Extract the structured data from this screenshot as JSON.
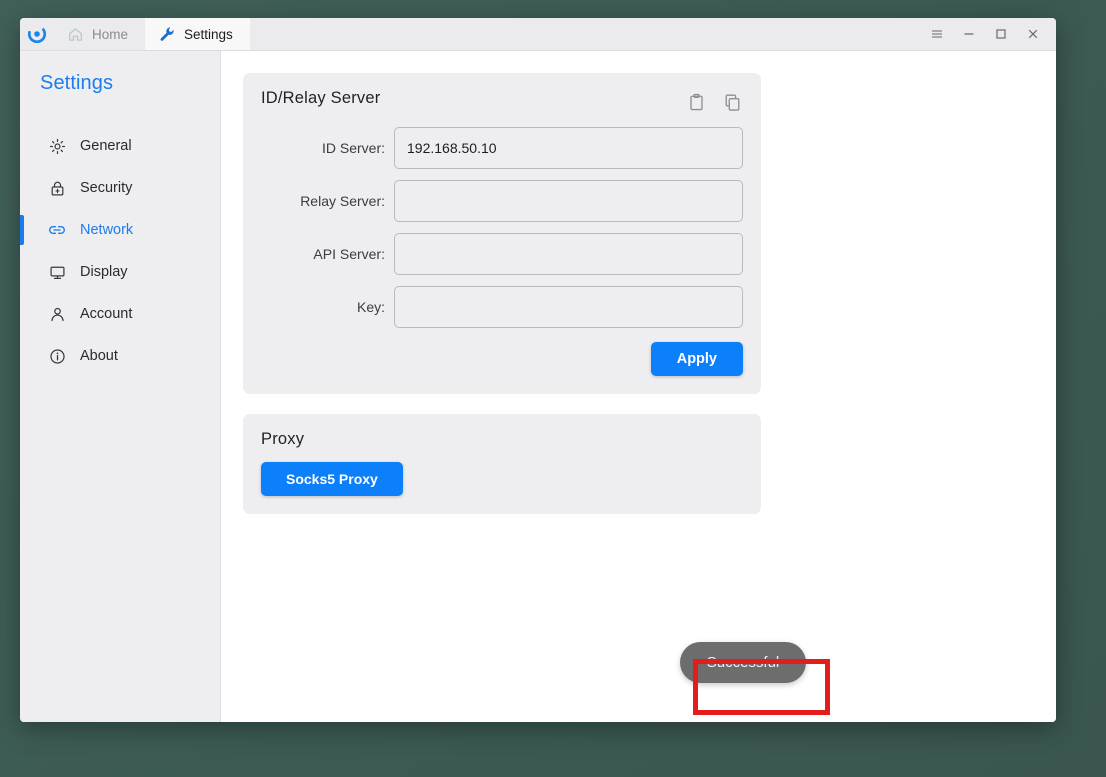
{
  "window": {
    "logo_icon": "app-logo-icon",
    "tabs": [
      {
        "label": "Home",
        "icon": "home-icon",
        "active": false
      },
      {
        "label": "Settings",
        "icon": "wrench-icon",
        "active": true
      }
    ],
    "controls": [
      {
        "name": "menu-button",
        "icon": "hamburger-icon"
      },
      {
        "name": "minimize-button",
        "icon": "minimize-icon"
      },
      {
        "name": "maximize-button",
        "icon": "maximize-icon"
      },
      {
        "name": "close-button",
        "icon": "close-icon"
      }
    ]
  },
  "sidebar": {
    "title": "Settings",
    "items": [
      {
        "label": "General",
        "icon": "gear-icon",
        "selected": false
      },
      {
        "label": "Security",
        "icon": "lock-icon",
        "selected": false
      },
      {
        "label": "Network",
        "icon": "link-icon",
        "selected": true
      },
      {
        "label": "Display",
        "icon": "monitor-icon",
        "selected": false
      },
      {
        "label": "Account",
        "icon": "person-icon",
        "selected": false
      },
      {
        "label": "About",
        "icon": "info-icon",
        "selected": false
      }
    ]
  },
  "id_relay_card": {
    "title": "ID/Relay Server",
    "actions": [
      {
        "name": "paste-button",
        "icon": "clipboard-icon"
      },
      {
        "name": "copy-button",
        "icon": "copy-icon"
      }
    ],
    "fields": [
      {
        "label": "ID Server:",
        "value": "192.168.50.10",
        "placeholder": ""
      },
      {
        "label": "Relay Server:",
        "value": "",
        "placeholder": ""
      },
      {
        "label": "API Server:",
        "value": "",
        "placeholder": ""
      },
      {
        "label": "Key:",
        "value": "",
        "placeholder": ""
      }
    ],
    "apply_label": "Apply"
  },
  "proxy_card": {
    "title": "Proxy",
    "button_label": "Socks5 Proxy"
  },
  "toast": {
    "message": "Successful"
  },
  "colors": {
    "accent": "#0c7ffb",
    "sidebar_accent": "#1c7ced",
    "toast_bg": "#6d6d6d",
    "annotation": "#e31c1c",
    "desktop": "#3e5d55",
    "card_bg": "#eeeef0"
  }
}
